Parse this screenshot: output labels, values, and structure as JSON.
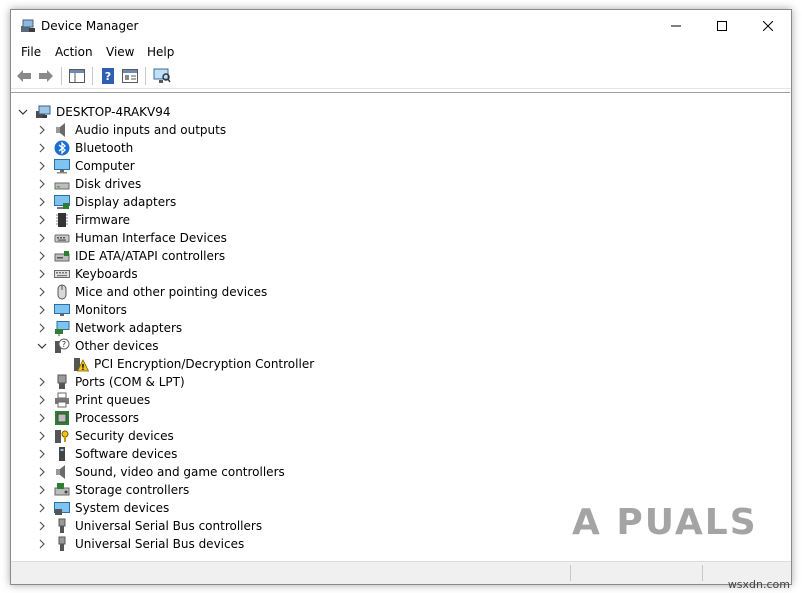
{
  "window": {
    "title": "Device Manager"
  },
  "menu": [
    "File",
    "Action",
    "View",
    "Help"
  ],
  "tree": {
    "root": "DESKTOP-4RAKV94",
    "items": [
      {
        "label": "Audio inputs and outputs",
        "icon": "speaker-icon",
        "expanded": false
      },
      {
        "label": "Bluetooth",
        "icon": "bluetooth-icon",
        "expanded": false
      },
      {
        "label": "Computer",
        "icon": "computer-icon",
        "expanded": false
      },
      {
        "label": "Disk drives",
        "icon": "disk-drive-icon",
        "expanded": false
      },
      {
        "label": "Display adapters",
        "icon": "display-adapter-icon",
        "expanded": false
      },
      {
        "label": "Firmware",
        "icon": "firmware-chip-icon",
        "expanded": false
      },
      {
        "label": "Human Interface Devices",
        "icon": "hid-icon",
        "expanded": false
      },
      {
        "label": "IDE ATA/ATAPI controllers",
        "icon": "ide-controller-icon",
        "expanded": false
      },
      {
        "label": "Keyboards",
        "icon": "keyboard-icon",
        "expanded": false
      },
      {
        "label": "Mice and other pointing devices",
        "icon": "mouse-icon",
        "expanded": false
      },
      {
        "label": "Monitors",
        "icon": "monitor-icon",
        "expanded": false
      },
      {
        "label": "Network adapters",
        "icon": "network-adapter-icon",
        "expanded": false
      },
      {
        "label": "Other devices",
        "icon": "unknown-device-icon",
        "expanded": true,
        "children": [
          {
            "label": "PCI Encryption/Decryption Controller",
            "icon": "warning-device-icon"
          }
        ]
      },
      {
        "label": "Ports (COM & LPT)",
        "icon": "port-icon",
        "expanded": false
      },
      {
        "label": "Print queues",
        "icon": "printer-icon",
        "expanded": false
      },
      {
        "label": "Processors",
        "icon": "processor-icon",
        "expanded": false
      },
      {
        "label": "Security devices",
        "icon": "security-device-icon",
        "expanded": false
      },
      {
        "label": "Software devices",
        "icon": "software-device-icon",
        "expanded": false
      },
      {
        "label": "Sound, video and game controllers",
        "icon": "sound-icon",
        "expanded": false
      },
      {
        "label": "Storage controllers",
        "icon": "storage-controller-icon",
        "expanded": false
      },
      {
        "label": "System devices",
        "icon": "system-device-icon",
        "expanded": false
      },
      {
        "label": "Universal Serial Bus controllers",
        "icon": "usb-icon",
        "expanded": false
      },
      {
        "label": "Universal Serial Bus devices",
        "icon": "usb-icon",
        "expanded": false
      }
    ]
  },
  "watermark": "A PUALS",
  "site_watermark": "wsxdn.com"
}
